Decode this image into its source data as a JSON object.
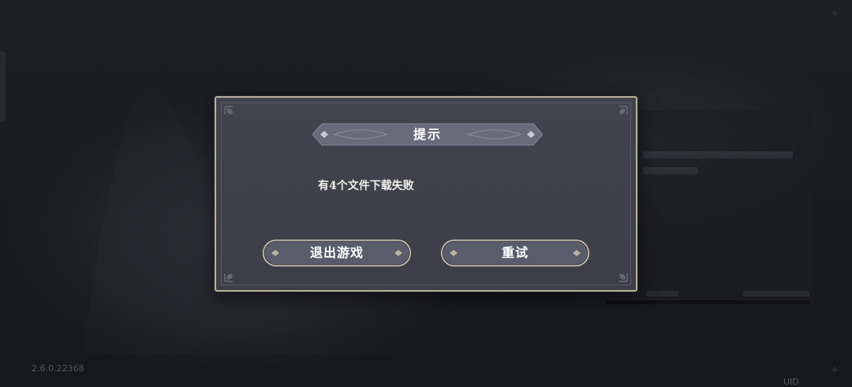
{
  "dialog": {
    "title": "提示",
    "message": "有4个文件下载失败",
    "buttons": {
      "exit_label": "退出游戏",
      "retry_label": "重试"
    }
  },
  "footer": {
    "version": "2.6.0.22368",
    "uid_label": "UID"
  },
  "colors": {
    "dialog_border": "#b7b09a",
    "dialog_bg": "#3f404a",
    "button_fill": "#5a5b6a",
    "text": "#ffffff"
  }
}
